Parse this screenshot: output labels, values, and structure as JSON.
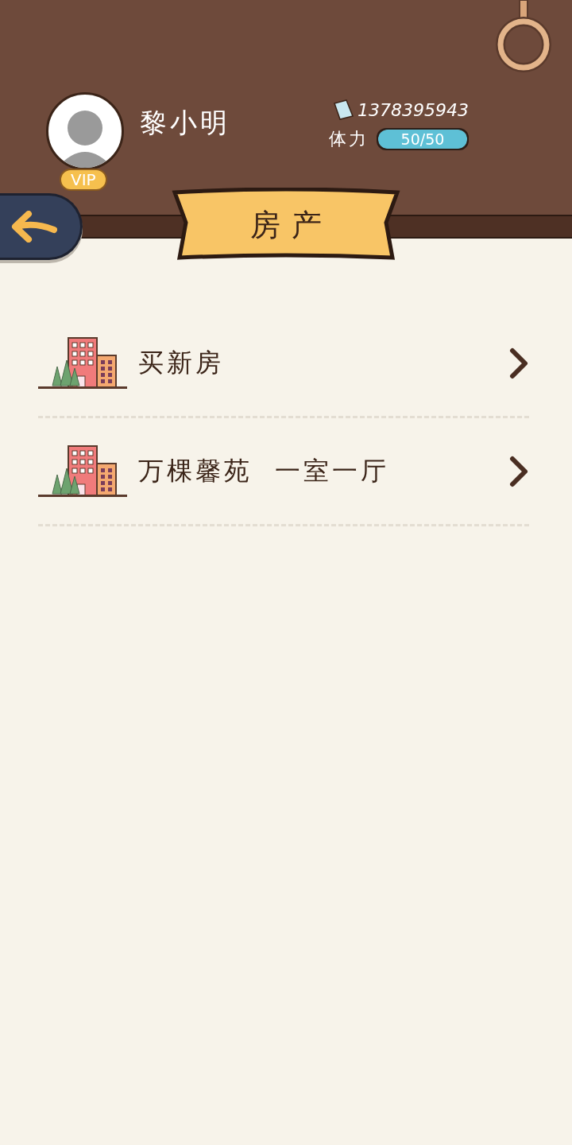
{
  "profile": {
    "name": "黎小明",
    "badge": "VIP",
    "money": "1378395943",
    "stamina_label": "体力",
    "stamina": {
      "reading": "50/50",
      "level": 1
    }
  },
  "title": "房产",
  "items": [
    {
      "label": "买新房"
    },
    {
      "label": "万棵馨苑  一室一厅"
    }
  ]
}
